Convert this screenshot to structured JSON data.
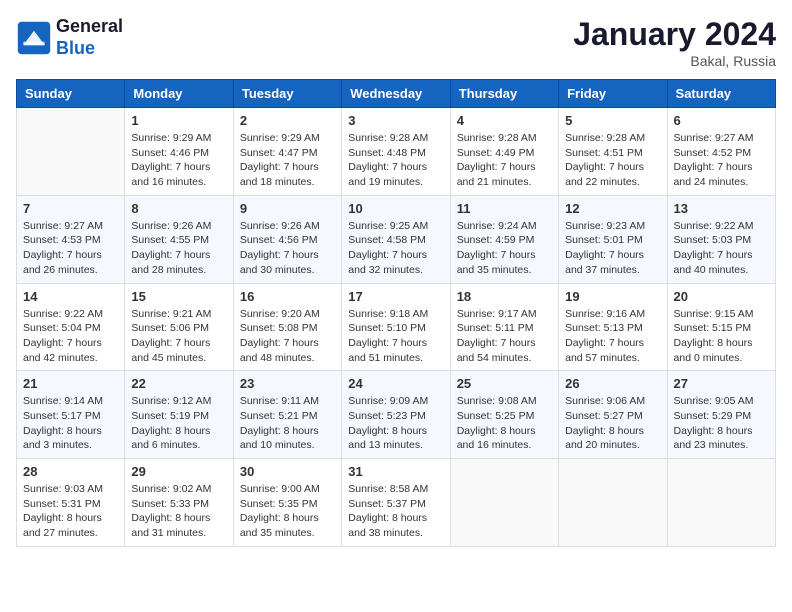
{
  "header": {
    "logo_line1": "General",
    "logo_line2": "Blue",
    "month_year": "January 2024",
    "location": "Bakal, Russia"
  },
  "columns": [
    "Sunday",
    "Monday",
    "Tuesday",
    "Wednesday",
    "Thursday",
    "Friday",
    "Saturday"
  ],
  "weeks": [
    [
      {
        "day": "",
        "sunrise": "",
        "sunset": "",
        "daylight": ""
      },
      {
        "day": "1",
        "sunrise": "Sunrise: 9:29 AM",
        "sunset": "Sunset: 4:46 PM",
        "daylight": "Daylight: 7 hours and 16 minutes."
      },
      {
        "day": "2",
        "sunrise": "Sunrise: 9:29 AM",
        "sunset": "Sunset: 4:47 PM",
        "daylight": "Daylight: 7 hours and 18 minutes."
      },
      {
        "day": "3",
        "sunrise": "Sunrise: 9:28 AM",
        "sunset": "Sunset: 4:48 PM",
        "daylight": "Daylight: 7 hours and 19 minutes."
      },
      {
        "day": "4",
        "sunrise": "Sunrise: 9:28 AM",
        "sunset": "Sunset: 4:49 PM",
        "daylight": "Daylight: 7 hours and 21 minutes."
      },
      {
        "day": "5",
        "sunrise": "Sunrise: 9:28 AM",
        "sunset": "Sunset: 4:51 PM",
        "daylight": "Daylight: 7 hours and 22 minutes."
      },
      {
        "day": "6",
        "sunrise": "Sunrise: 9:27 AM",
        "sunset": "Sunset: 4:52 PM",
        "daylight": "Daylight: 7 hours and 24 minutes."
      }
    ],
    [
      {
        "day": "7",
        "sunrise": "Sunrise: 9:27 AM",
        "sunset": "Sunset: 4:53 PM",
        "daylight": "Daylight: 7 hours and 26 minutes."
      },
      {
        "day": "8",
        "sunrise": "Sunrise: 9:26 AM",
        "sunset": "Sunset: 4:55 PM",
        "daylight": "Daylight: 7 hours and 28 minutes."
      },
      {
        "day": "9",
        "sunrise": "Sunrise: 9:26 AM",
        "sunset": "Sunset: 4:56 PM",
        "daylight": "Daylight: 7 hours and 30 minutes."
      },
      {
        "day": "10",
        "sunrise": "Sunrise: 9:25 AM",
        "sunset": "Sunset: 4:58 PM",
        "daylight": "Daylight: 7 hours and 32 minutes."
      },
      {
        "day": "11",
        "sunrise": "Sunrise: 9:24 AM",
        "sunset": "Sunset: 4:59 PM",
        "daylight": "Daylight: 7 hours and 35 minutes."
      },
      {
        "day": "12",
        "sunrise": "Sunrise: 9:23 AM",
        "sunset": "Sunset: 5:01 PM",
        "daylight": "Daylight: 7 hours and 37 minutes."
      },
      {
        "day": "13",
        "sunrise": "Sunrise: 9:22 AM",
        "sunset": "Sunset: 5:03 PM",
        "daylight": "Daylight: 7 hours and 40 minutes."
      }
    ],
    [
      {
        "day": "14",
        "sunrise": "Sunrise: 9:22 AM",
        "sunset": "Sunset: 5:04 PM",
        "daylight": "Daylight: 7 hours and 42 minutes."
      },
      {
        "day": "15",
        "sunrise": "Sunrise: 9:21 AM",
        "sunset": "Sunset: 5:06 PM",
        "daylight": "Daylight: 7 hours and 45 minutes."
      },
      {
        "day": "16",
        "sunrise": "Sunrise: 9:20 AM",
        "sunset": "Sunset: 5:08 PM",
        "daylight": "Daylight: 7 hours and 48 minutes."
      },
      {
        "day": "17",
        "sunrise": "Sunrise: 9:18 AM",
        "sunset": "Sunset: 5:10 PM",
        "daylight": "Daylight: 7 hours and 51 minutes."
      },
      {
        "day": "18",
        "sunrise": "Sunrise: 9:17 AM",
        "sunset": "Sunset: 5:11 PM",
        "daylight": "Daylight: 7 hours and 54 minutes."
      },
      {
        "day": "19",
        "sunrise": "Sunrise: 9:16 AM",
        "sunset": "Sunset: 5:13 PM",
        "daylight": "Daylight: 7 hours and 57 minutes."
      },
      {
        "day": "20",
        "sunrise": "Sunrise: 9:15 AM",
        "sunset": "Sunset: 5:15 PM",
        "daylight": "Daylight: 8 hours and 0 minutes."
      }
    ],
    [
      {
        "day": "21",
        "sunrise": "Sunrise: 9:14 AM",
        "sunset": "Sunset: 5:17 PM",
        "daylight": "Daylight: 8 hours and 3 minutes."
      },
      {
        "day": "22",
        "sunrise": "Sunrise: 9:12 AM",
        "sunset": "Sunset: 5:19 PM",
        "daylight": "Daylight: 8 hours and 6 minutes."
      },
      {
        "day": "23",
        "sunrise": "Sunrise: 9:11 AM",
        "sunset": "Sunset: 5:21 PM",
        "daylight": "Daylight: 8 hours and 10 minutes."
      },
      {
        "day": "24",
        "sunrise": "Sunrise: 9:09 AM",
        "sunset": "Sunset: 5:23 PM",
        "daylight": "Daylight: 8 hours and 13 minutes."
      },
      {
        "day": "25",
        "sunrise": "Sunrise: 9:08 AM",
        "sunset": "Sunset: 5:25 PM",
        "daylight": "Daylight: 8 hours and 16 minutes."
      },
      {
        "day": "26",
        "sunrise": "Sunrise: 9:06 AM",
        "sunset": "Sunset: 5:27 PM",
        "daylight": "Daylight: 8 hours and 20 minutes."
      },
      {
        "day": "27",
        "sunrise": "Sunrise: 9:05 AM",
        "sunset": "Sunset: 5:29 PM",
        "daylight": "Daylight: 8 hours and 23 minutes."
      }
    ],
    [
      {
        "day": "28",
        "sunrise": "Sunrise: 9:03 AM",
        "sunset": "Sunset: 5:31 PM",
        "daylight": "Daylight: 8 hours and 27 minutes."
      },
      {
        "day": "29",
        "sunrise": "Sunrise: 9:02 AM",
        "sunset": "Sunset: 5:33 PM",
        "daylight": "Daylight: 8 hours and 31 minutes."
      },
      {
        "day": "30",
        "sunrise": "Sunrise: 9:00 AM",
        "sunset": "Sunset: 5:35 PM",
        "daylight": "Daylight: 8 hours and 35 minutes."
      },
      {
        "day": "31",
        "sunrise": "Sunrise: 8:58 AM",
        "sunset": "Sunset: 5:37 PM",
        "daylight": "Daylight: 8 hours and 38 minutes."
      },
      {
        "day": "",
        "sunrise": "",
        "sunset": "",
        "daylight": ""
      },
      {
        "day": "",
        "sunrise": "",
        "sunset": "",
        "daylight": ""
      },
      {
        "day": "",
        "sunrise": "",
        "sunset": "",
        "daylight": ""
      }
    ]
  ]
}
